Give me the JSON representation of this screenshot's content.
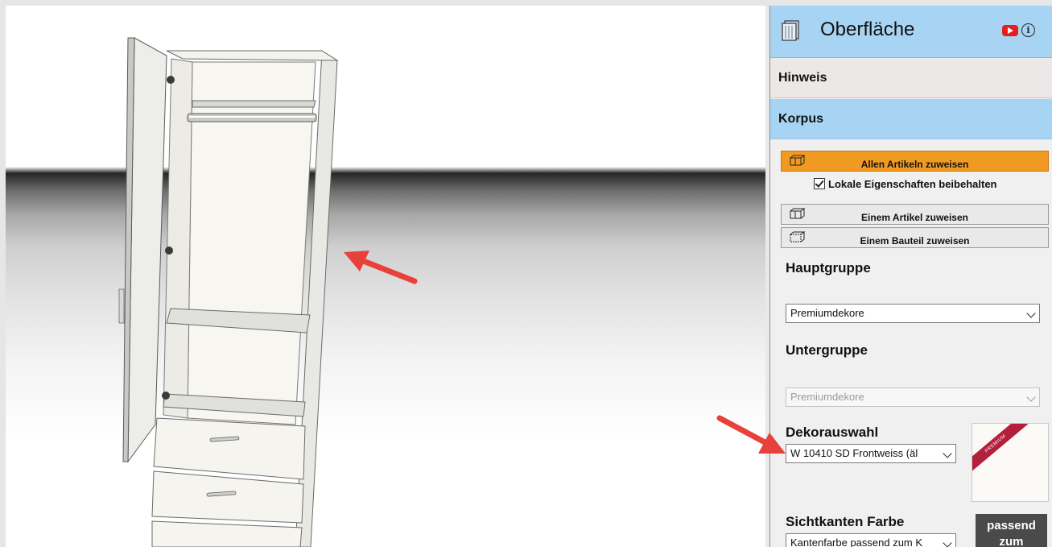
{
  "panel": {
    "title": "Oberfläche",
    "sections": {
      "hinweis": "Hinweis",
      "korpus": "Korpus"
    },
    "buttons": {
      "allen_artikeln": "Allen Artikeln zuweisen",
      "einem_artikel": "Einem Artikel zuweisen",
      "einem_bauteil": "Einem Bauteil zuweisen"
    },
    "checkbox": {
      "label": "Lokale Eigenschaften beibehalten",
      "checked": true
    },
    "hauptgruppe": {
      "label": "Hauptgruppe",
      "value": "Premiumdekore"
    },
    "untergruppe": {
      "label": "Untergruppe",
      "value": "Premiumdekore",
      "disabled": true
    },
    "dekorauswahl": {
      "label": "Dekorauswahl",
      "value": "W 10410 SD Frontweiss (äl",
      "preview_badge": "PREMIUM"
    },
    "sichtkanten": {
      "label": "Sichtkanten Farbe",
      "value": "Kantenfarbe passend zum K",
      "button": "passend zum"
    },
    "icons": [
      "surface-icon",
      "youtube-icon",
      "info-icon",
      "box-icon",
      "checkbox-icon",
      "chevron-down-icon"
    ],
    "colors": {
      "header_blue": "#a8d4f3",
      "orange_button": "#f19a22",
      "annotation_arrow": "#e8403a",
      "premium_ribbon": "#b3203c"
    }
  }
}
